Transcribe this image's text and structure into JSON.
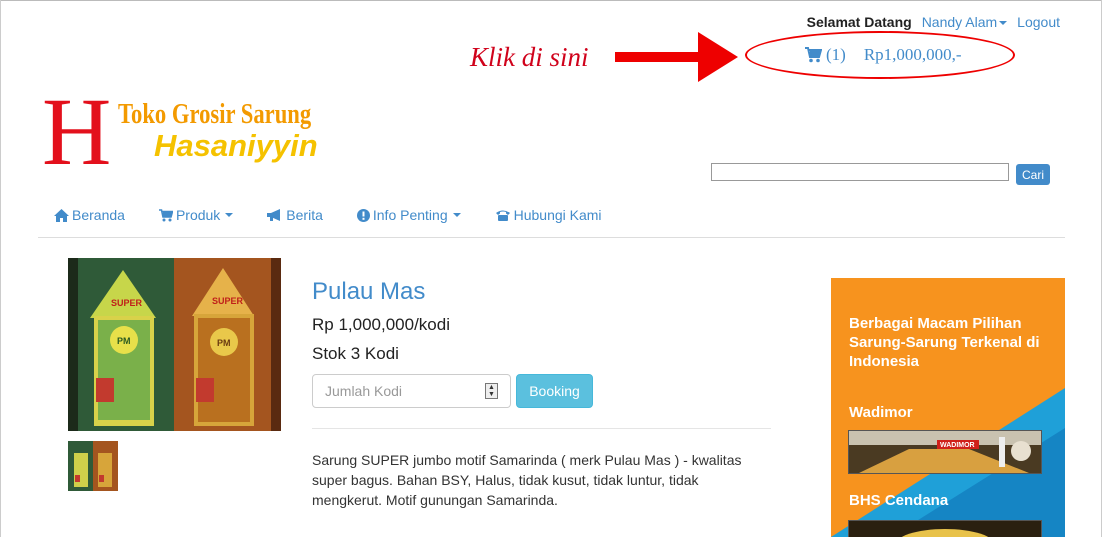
{
  "header": {
    "welcome": "Selamat Datang",
    "user": "Nandy Alam",
    "logout": "Logout",
    "cart_count": "(1)",
    "cart_total": "Rp1,000,000,-"
  },
  "annotation": {
    "text": "Klik di sini",
    "color": "#d0021b"
  },
  "logo": {
    "letter": "H",
    "line1": "Toko Grosir Sarung",
    "line2": "Hasaniyyin"
  },
  "search": {
    "button": "Cari",
    "value": ""
  },
  "nav": {
    "home": "Beranda",
    "produk": "Produk",
    "berita": "Berita",
    "info": "Info Penting",
    "kontak": "Hubungi Kami"
  },
  "product": {
    "title": "Pulau Mas",
    "price": "Rp 1,000,000/kodi",
    "stock": "Stok 3 Kodi",
    "qty_placeholder": "Jumlah Kodi",
    "book_button": "Booking",
    "description": "Sarung SUPER jumbo motif Samarinda ( merk Pulau Mas ) - kwalitas super bagus. Bahan BSY, Halus, tidak kusut, tidak luntur, tidak mengkerut. Motif gunungan Samarinda.",
    "package_label": "SUPER",
    "package_brand": "PM"
  },
  "sidebar": {
    "tagline": "Berbagai Macam Pilihan Sarung-Sarung Terkenal di Indonesia",
    "brand1": "Wadimor",
    "brand1_logo": "WADIMOR",
    "brand2": "BHS Cendana"
  },
  "colors": {
    "link": "#428bca",
    "orange": "#f7931e",
    "info_btn": "#5bc0de",
    "red": "#e3101c"
  }
}
